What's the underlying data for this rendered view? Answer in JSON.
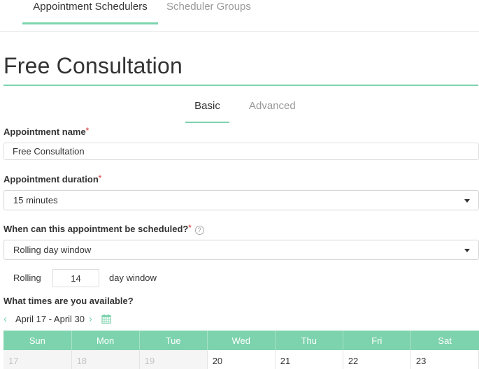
{
  "top_tabs": [
    {
      "label": "Appointment Schedulers",
      "active": true
    },
    {
      "label": "Scheduler Groups",
      "active": false
    }
  ],
  "page_title": "Free Consultation",
  "sub_tabs": [
    {
      "label": "Basic",
      "active": true
    },
    {
      "label": "Advanced",
      "active": false
    }
  ],
  "form": {
    "name_label": "Appointment name",
    "name_value": "Free Consultation",
    "duration_label": "Appointment duration",
    "duration_value": "15 minutes",
    "schedule_label": "When can this appointment be scheduled?",
    "schedule_help": "?",
    "schedule_value": "Rolling day window",
    "required_mark": "*",
    "rolling_prefix": "Rolling",
    "rolling_days": "14",
    "rolling_suffix": "day window"
  },
  "availability": {
    "label": "What times are you available?",
    "prev_icon": "chevron-left",
    "next_icon": "chevron-right",
    "range": "April 17 -  April 30",
    "prev_glyph": "‹",
    "next_glyph": "›",
    "days": [
      "Sun",
      "Mon",
      "Tue",
      "Wed",
      "Thu",
      "Fri",
      "Sat"
    ],
    "dates": [
      {
        "day": "17",
        "past": true
      },
      {
        "day": "18",
        "past": true
      },
      {
        "day": "19",
        "past": true
      },
      {
        "day": "20",
        "past": false
      },
      {
        "day": "21",
        "past": false
      },
      {
        "day": "22",
        "past": false
      },
      {
        "day": "23",
        "past": false
      }
    ]
  },
  "colors": {
    "accent": "#7dd3ad",
    "required": "#e05a5a"
  }
}
